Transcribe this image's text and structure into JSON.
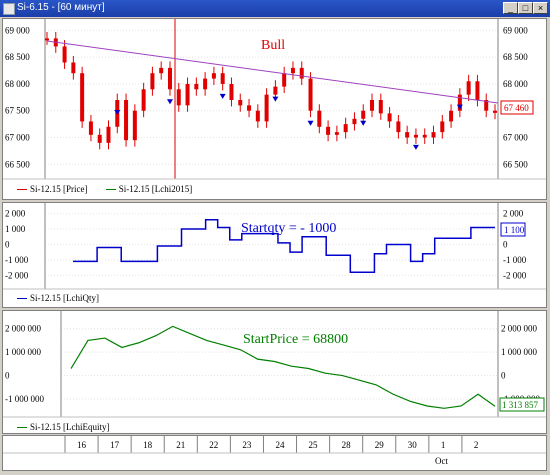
{
  "window": {
    "title": "Si-6.15 - [60 минут]",
    "minimize": "_",
    "maximize": "□",
    "close": "×"
  },
  "colors": {
    "price": "#e00000",
    "trend": "#a040c0",
    "qty": "#0000cc",
    "equity": "#008000",
    "cursor": "#e00000"
  },
  "pane1": {
    "annotation": "Bull",
    "y_ticks": [
      "69 000",
      "68 500",
      "68 000",
      "67 500",
      "67 000",
      "66 500"
    ],
    "last_value": "67 460",
    "legend": [
      "Si-12.15 [Price]",
      "Si-12.15 [Lchi2015]"
    ]
  },
  "pane2": {
    "annotation": "Startqty = - 1000",
    "y_ticks": [
      "2 000",
      "1 000",
      "0",
      "-1 000",
      "-2 000"
    ],
    "last_value": "1 100",
    "legend": [
      "Si-12.15 [LchiQty]"
    ]
  },
  "pane3": {
    "annotation": "StartPrice = 68800",
    "y_ticks_left": [
      "2 000 000",
      "1 000 000",
      "0",
      "-1 000 000"
    ],
    "y_ticks_right": [
      "2 000 000",
      "1 000 000",
      "0",
      "-1 000 000"
    ],
    "last_value": "1 313 857",
    "legend": [
      "Si-12.15 [LchiEquity]"
    ]
  },
  "time_axis": {
    "days": [
      "16",
      "17",
      "18",
      "21",
      "22",
      "23",
      "24",
      "25",
      "28",
      "29",
      "30",
      "1",
      "2"
    ],
    "month": "Oct"
  },
  "chart_data": [
    {
      "type": "line",
      "title": "",
      "series": [
        {
          "name": "Si-12.15 [Price]",
          "values": [
            68850,
            68700,
            68400,
            68200,
            67300,
            67050,
            66900,
            67200,
            67700,
            66950,
            67500,
            67900,
            68200,
            68300,
            67900,
            67600,
            68000,
            67900,
            68100,
            68200,
            68000,
            67700,
            67600,
            67500,
            67300,
            67800,
            67950,
            68200,
            68300,
            68100,
            67500,
            67200,
            67050,
            67100,
            67250,
            67350,
            67500,
            67700,
            67450,
            67300,
            67100,
            67000,
            67050,
            67000,
            67100,
            67300,
            67500,
            67800,
            68050,
            67700,
            67500,
            67460
          ]
        },
        {
          "name": "Si-12.15 [Lchi2015]",
          "values": [
            68850,
            68800,
            68700,
            68650,
            68600,
            68550,
            68500,
            68450,
            68400,
            68350,
            68300,
            68250,
            68200,
            68150,
            68100,
            68050,
            68000,
            67950,
            67900,
            67850,
            67800,
            67750,
            67700,
            67650,
            67600,
            67500
          ]
        }
      ],
      "ylim": [
        66300,
        69100
      ]
    },
    {
      "type": "line",
      "title": "",
      "series": [
        {
          "name": "Si-12.15 [LchiQty]",
          "values": [
            -1100,
            -1100,
            -200,
            -200,
            -1100,
            -1100,
            -1100,
            -100,
            -100,
            1000,
            1000,
            1600,
            1100,
            300,
            700,
            700,
            700,
            100,
            -500,
            500,
            500,
            -700,
            -700,
            -1800,
            -1800,
            -600,
            0,
            0,
            -1100,
            -600,
            400,
            400,
            400,
            1100,
            1100,
            1100
          ]
        }
      ],
      "ylim": [
        -2500,
        2300
      ]
    },
    {
      "type": "line",
      "title": "",
      "series": [
        {
          "name": "Si-12.15 [LchiEquity]",
          "values": [
            300000,
            1500000,
            1600000,
            1200000,
            1400000,
            1700000,
            2100000,
            1800000,
            1500000,
            1300000,
            1100000,
            700000,
            600000,
            400000,
            300000,
            100000,
            0,
            -200000,
            -400000,
            -800000,
            -1100000,
            -1300000,
            -1400000,
            -1300000,
            -800000,
            -1313857
          ]
        }
      ],
      "ylim": [
        -1600000,
        2500000
      ]
    }
  ]
}
